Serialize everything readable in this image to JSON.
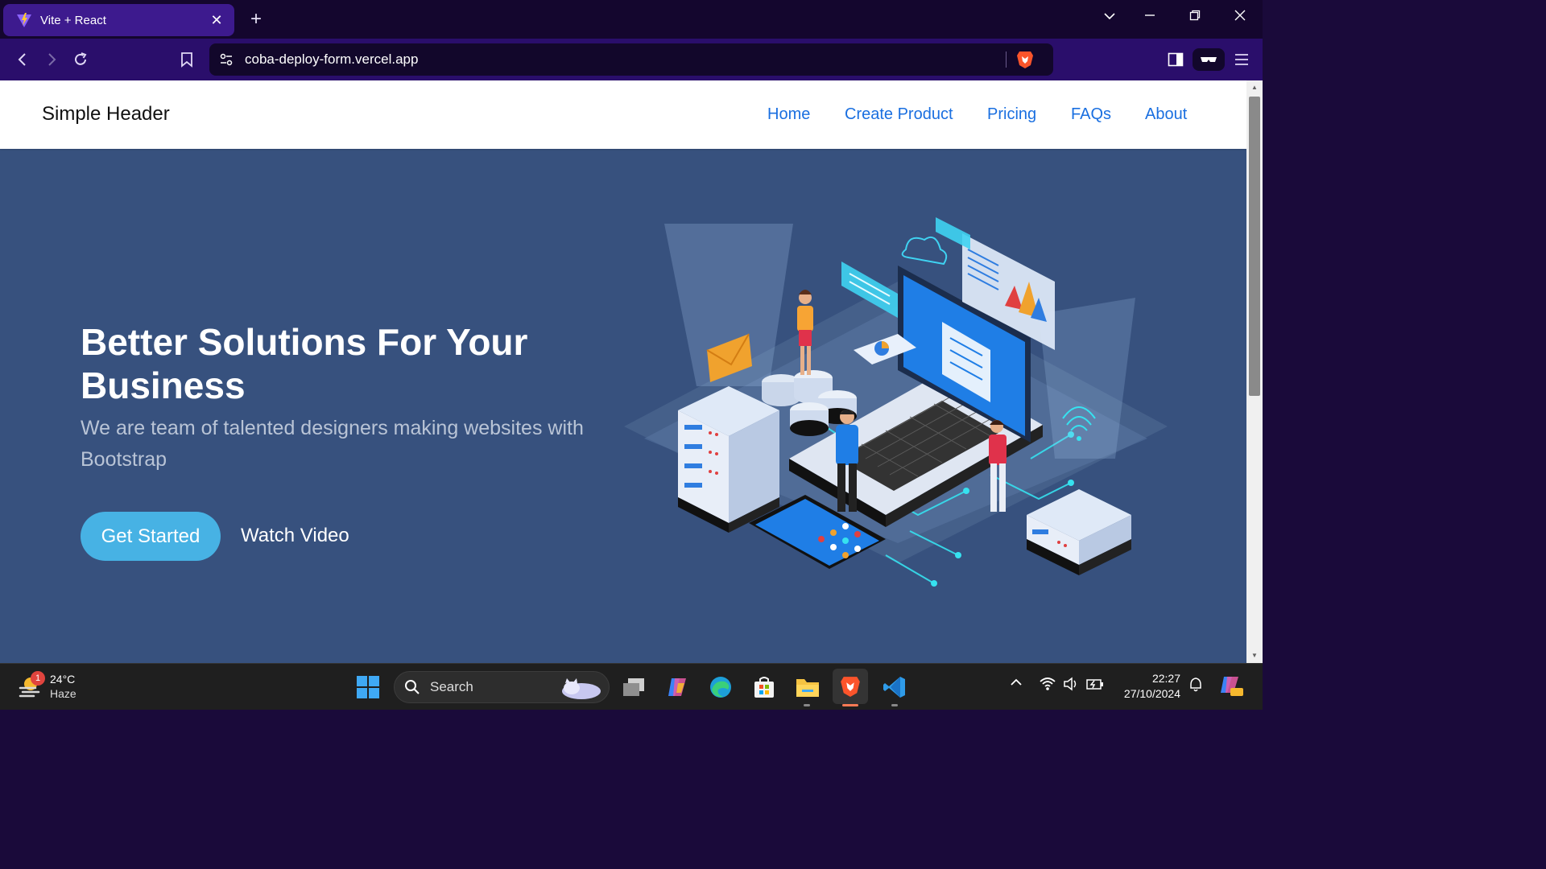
{
  "browser": {
    "tab_title": "Vite + React",
    "url": "coba-deploy-form.vercel.app"
  },
  "site": {
    "brand": "Simple Header",
    "nav": [
      "Home",
      "Create Product",
      "Pricing",
      "FAQs",
      "About"
    ]
  },
  "hero": {
    "title": "Better Solutions For Your Business",
    "subtitle": "We are team of talented designers making websites with Bootstrap",
    "cta_primary": "Get Started",
    "cta_secondary": "Watch Video",
    "accent_color": "#47b2e4",
    "background_color": "#37517e"
  },
  "taskbar": {
    "weather_temp": "24°C",
    "weather_condition": "Haze",
    "weather_badge": "1",
    "search_placeholder": "Search",
    "time": "22:27",
    "date": "27/10/2024",
    "apps": [
      "start-icon",
      "task-view-icon",
      "copilot-icon",
      "edge-icon",
      "store-icon",
      "file-explorer-icon",
      "brave-icon",
      "vscode-icon"
    ]
  }
}
